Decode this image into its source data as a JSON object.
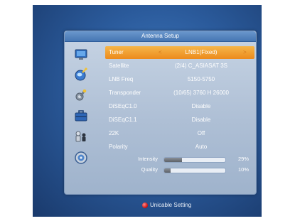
{
  "window": {
    "title": "Antenna Setup"
  },
  "icons": [
    {
      "name": "tv-icon"
    },
    {
      "name": "satellite-dish-icon"
    },
    {
      "name": "tools-icon"
    },
    {
      "name": "briefcase-icon"
    },
    {
      "name": "chess-pieces-icon"
    },
    {
      "name": "disc-icon"
    }
  ],
  "settings": [
    {
      "label": "Tuner",
      "value": "LNB1(Fixed)",
      "selected": true
    },
    {
      "label": "Satellite",
      "value": "(2/4) C_ASIASAT 3S"
    },
    {
      "label": "LNB Freq",
      "value": "5150-5750"
    },
    {
      "label": "Transponder",
      "value": "(10/65) 3760 H 26000"
    },
    {
      "label": "DiSEqC1.0",
      "value": "Disable"
    },
    {
      "label": "DiSEqC1.1",
      "value": "Disable"
    },
    {
      "label": "22K",
      "value": "Off"
    },
    {
      "label": "Polarity",
      "value": "Auto"
    }
  ],
  "signal": {
    "intensity": {
      "label": "Intensity",
      "text": "29%",
      "value": 29
    },
    "quality": {
      "label": "Quality",
      "text": "10%",
      "value": 10
    }
  },
  "arrows": {
    "left": "<",
    "right": ">"
  },
  "footer": {
    "hint": "Unicable Setting",
    "hint_color": "#d21a1a"
  },
  "colors": {
    "highlight": "#ec8a1c",
    "title_bar": "#4676b3"
  }
}
